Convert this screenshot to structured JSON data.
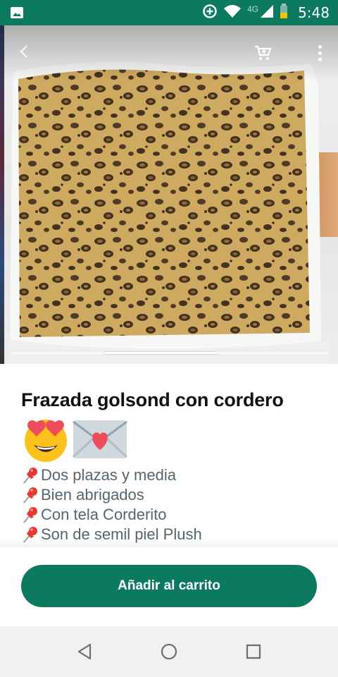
{
  "status_bar": {
    "time": "5:48",
    "network": "4G",
    "icons": [
      "image-icon",
      "data-saver-icon",
      "wifi-icon",
      "signal-icon",
      "battery-icon"
    ],
    "color": "#0b7a5f"
  },
  "product": {
    "image_alt_icons": [
      "back-icon",
      "cart-icon",
      "more-icon"
    ],
    "title": "Frazada golsond con cordero",
    "title_emojis": [
      "heart-eyes-emoji",
      "love-letter-emoji"
    ],
    "description": [
      "Dos plazas y media",
      "Bien abrigados",
      "Con tela Corderito",
      "Son de semil piel Plush"
    ]
  },
  "actions": {
    "add_to_cart_label": "Añadir al carrito",
    "accent_color": "#0b7a5f"
  },
  "nav": {
    "icons": [
      "back-triangle-icon",
      "home-circle-icon",
      "recents-square-icon"
    ]
  }
}
